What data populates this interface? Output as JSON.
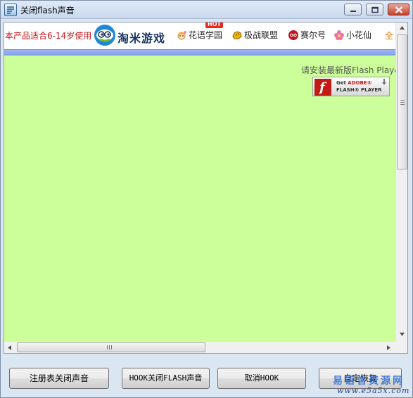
{
  "window": {
    "title": "关闭flash声音",
    "controls": {
      "minimize": "minimize",
      "maximize": "maximize",
      "close": "close"
    }
  },
  "topbar": {
    "age_notice": "本产品适合6-14岁使用",
    "logo_text": "淘米游戏",
    "nav": [
      {
        "label": "花语学园",
        "icon": "flower-girl-icon",
        "badge": "HOT"
      },
      {
        "label": "极战联盟",
        "icon": "fist-icon"
      },
      {
        "label": "赛尔号",
        "icon": "seer-robot-icon"
      },
      {
        "label": "小花仙",
        "icon": "pink-flower-icon"
      }
    ],
    "more_label": "全"
  },
  "flash": {
    "install_message": "请安装最新版Flash Player",
    "get_line_1a": "Get ",
    "get_line_1b": "ADOBE®",
    "get_line_2": "FLASH® PLAYER",
    "logo_letter": "f"
  },
  "buttons": {
    "registry_mute": "注册表关闭声音",
    "hook_mute": "HOOK关闭FLASH声音",
    "cancel_hook": "取消HOOK",
    "restore": "自定恢复"
  },
  "watermark": {
    "line1": "易语言资源网",
    "line2": "www.e5a5x.com"
  },
  "colors": {
    "game_bg": "#ccff99",
    "age_notice": "#c8161d",
    "blue_strip": "#7f9fe6",
    "close_button": "#c7402d"
  }
}
